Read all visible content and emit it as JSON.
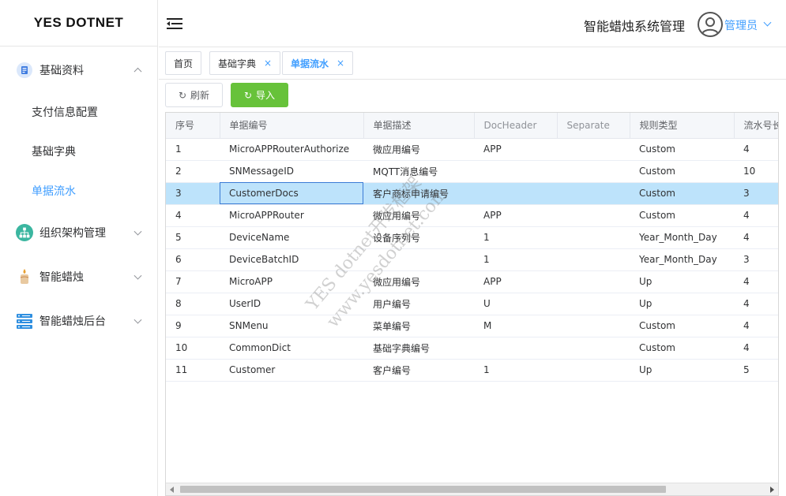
{
  "brand": "YES DOTNET",
  "sidebar": {
    "groups": [
      {
        "label": "基础资料",
        "icon": "document-icon",
        "expanded": true
      },
      {
        "label": "组织架构管理",
        "icon": "org-chart-icon",
        "expanded": false
      },
      {
        "label": "智能蜡烛",
        "icon": "candle-icon",
        "expanded": false
      },
      {
        "label": "智能蜡烛后台",
        "icon": "server-icon",
        "expanded": false
      }
    ],
    "sub_items": [
      {
        "label": "支付信息配置"
      },
      {
        "label": "基础字典"
      },
      {
        "label": "单据流水",
        "active": true
      }
    ]
  },
  "header": {
    "system_title": "智能蜡烛系统管理",
    "user_name": "管理员"
  },
  "tags": [
    {
      "label": "首页"
    },
    {
      "label": "基础字典",
      "close": "×"
    },
    {
      "label": "单据流水",
      "close": "×",
      "active": true
    }
  ],
  "toolbar": {
    "refresh_icon": "↻",
    "refresh_label": "刷新",
    "import_icon": "↻",
    "import_label": "导入"
  },
  "table": {
    "columns": [
      "序号",
      "单据编号",
      "单据描述",
      "DocHeader",
      "Separate",
      "规则类型",
      "流水号长"
    ],
    "rows": [
      [
        "1",
        "MicroAPPRouterAuthorize",
        "微应用编号",
        "APP",
        "",
        "Custom",
        "4"
      ],
      [
        "2",
        "SNMessageID",
        "MQTT消息编号",
        "",
        "",
        "Custom",
        "10"
      ],
      [
        "3",
        "CustomerDocs",
        "客户商标申请编号",
        "",
        "",
        "Custom",
        "3"
      ],
      [
        "4",
        "MicroAPPRouter",
        "微应用编号",
        "APP",
        "",
        "Custom",
        "4"
      ],
      [
        "5",
        "DeviceName",
        "设备序列号",
        "1",
        "",
        "Year_Month_Day",
        "4"
      ],
      [
        "6",
        "DeviceBatchID",
        "",
        "1",
        "",
        "Year_Month_Day",
        "3"
      ],
      [
        "7",
        "MicroAPP",
        "微应用编号",
        "APP",
        "",
        "Up",
        "4"
      ],
      [
        "8",
        "UserID",
        "用户编号",
        "U",
        "",
        "Up",
        "4"
      ],
      [
        "9",
        "SNMenu",
        "菜单编号",
        "M",
        "",
        "Custom",
        "4"
      ],
      [
        "10",
        "CommonDict",
        "基础字典编号",
        "",
        "",
        "Custom",
        "4"
      ],
      [
        "11",
        "Customer",
        "客户编号",
        "1",
        "",
        "Up",
        "5"
      ]
    ],
    "selected_row": 2
  },
  "watermark": {
    "line1": "YES dotnet开发框架",
    "line2": "www.yesdotnet.com"
  },
  "colors": {
    "accent": "#409eff",
    "import_green": "#67c23a",
    "selected_row": "#bde3fb"
  }
}
